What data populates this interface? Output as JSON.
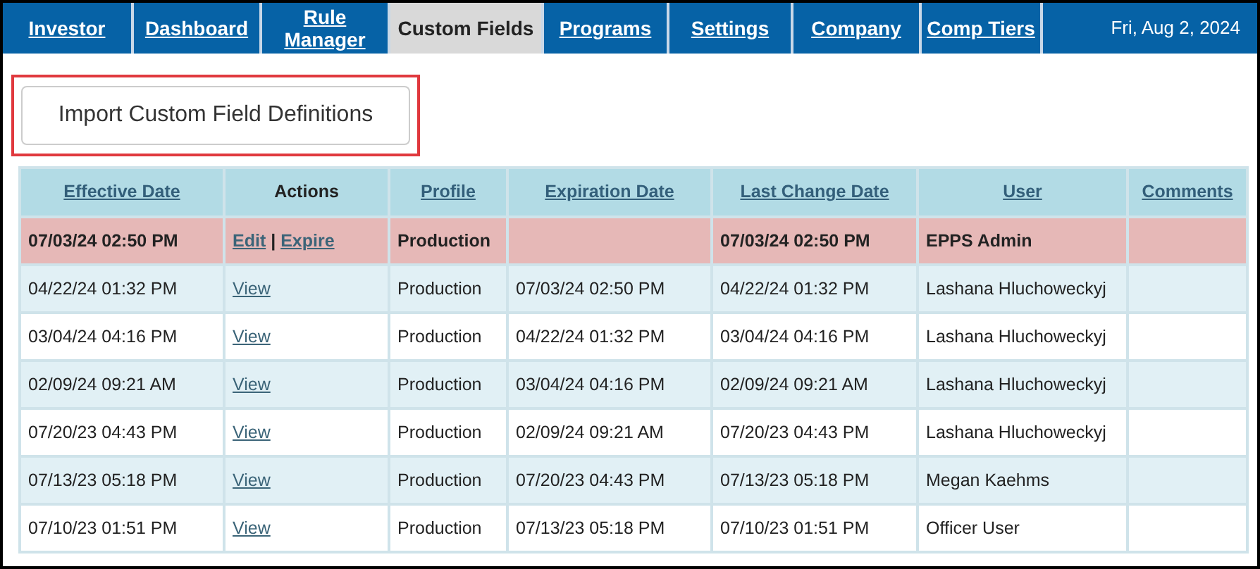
{
  "nav": {
    "tabs": [
      {
        "label": "Investor",
        "selected": false
      },
      {
        "label": "Dashboard",
        "selected": false
      },
      {
        "label": "Rule Manager",
        "selected": false
      },
      {
        "label": "Custom Fields",
        "selected": true
      },
      {
        "label": "Programs",
        "selected": false
      },
      {
        "label": "Settings",
        "selected": false
      },
      {
        "label": "Company",
        "selected": false
      },
      {
        "label": "Comp Tiers",
        "selected": false
      }
    ],
    "date": "Fri, Aug 2, 2024"
  },
  "action_separator": "|",
  "import_button": "Import Custom Field Definitions",
  "table": {
    "columns": [
      {
        "label": "Effective Date",
        "sortable": true
      },
      {
        "label": "Actions",
        "sortable": false
      },
      {
        "label": "Profile",
        "sortable": true
      },
      {
        "label": "Expiration Date",
        "sortable": true
      },
      {
        "label": "Last Change Date",
        "sortable": true
      },
      {
        "label": "User",
        "sortable": true
      },
      {
        "label": "Comments",
        "sortable": true
      }
    ],
    "rows": [
      {
        "selected": true,
        "effective": "07/03/24 02:50 PM",
        "actions": [
          "Edit",
          "Expire"
        ],
        "profile": "Production",
        "expiration": "",
        "last_change": "07/03/24 02:50 PM",
        "user": "EPPS Admin"
      },
      {
        "selected": false,
        "effective": "04/22/24 01:32 PM",
        "actions": [
          "View"
        ],
        "profile": "Production",
        "expiration": "07/03/24 02:50 PM",
        "last_change": "04/22/24 01:32 PM",
        "user": "Lashana Hluchoweckyj"
      },
      {
        "selected": false,
        "effective": "03/04/24 04:16 PM",
        "actions": [
          "View"
        ],
        "profile": "Production",
        "expiration": "04/22/24 01:32 PM",
        "last_change": "03/04/24 04:16 PM",
        "user": "Lashana Hluchoweckyj"
      },
      {
        "selected": false,
        "effective": "02/09/24 09:21 AM",
        "actions": [
          "View"
        ],
        "profile": "Production",
        "expiration": "03/04/24 04:16 PM",
        "last_change": "02/09/24 09:21 AM",
        "user": "Lashana Hluchoweckyj"
      },
      {
        "selected": false,
        "effective": "07/20/23 04:43 PM",
        "actions": [
          "View"
        ],
        "profile": "Production",
        "expiration": "02/09/24 09:21 AM",
        "last_change": "07/20/23 04:43 PM",
        "user": "Lashana Hluchoweckyj"
      },
      {
        "selected": false,
        "effective": "07/13/23 05:18 PM",
        "actions": [
          "View"
        ],
        "profile": "Production",
        "expiration": "07/20/23 04:43 PM",
        "last_change": "07/13/23 05:18 PM",
        "user": "Megan Kaehms"
      },
      {
        "selected": false,
        "effective": "07/10/23 01:51 PM",
        "actions": [
          "View"
        ],
        "profile": "Production",
        "expiration": "07/13/23 05:18 PM",
        "last_change": "07/10/23 01:51 PM",
        "user": "Officer User"
      }
    ]
  }
}
